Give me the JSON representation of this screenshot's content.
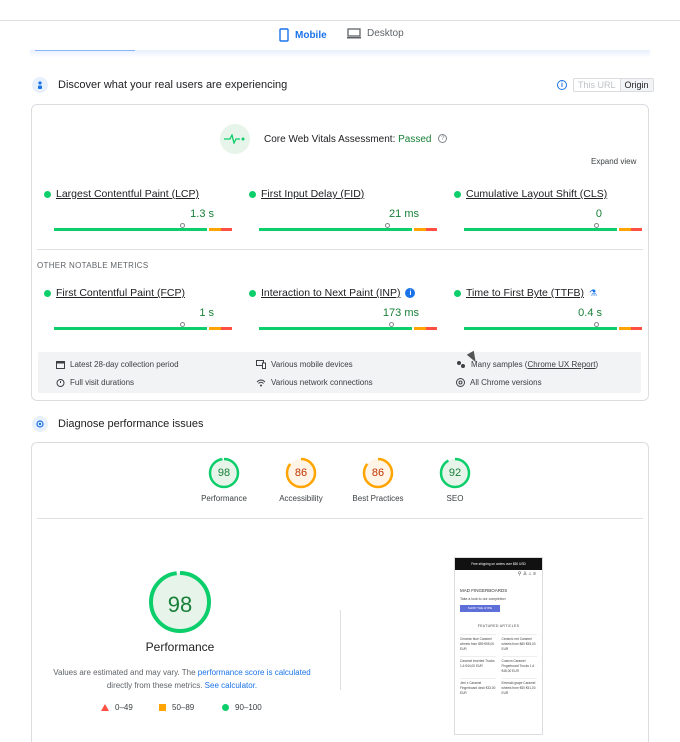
{
  "device_tabs": {
    "mobile": "Mobile",
    "desktop": "Desktop"
  },
  "field": {
    "heading": "Discover what your real users are experiencing",
    "toggle": {
      "this_url": "This URL",
      "origin": "Origin"
    },
    "assessment_label": "Core Web Vitals Assessment:",
    "assessment_status": "Passed",
    "expand": "Expand view",
    "core_metrics": [
      {
        "name": "Largest Contentful Paint (LCP)",
        "value": "1.3 s",
        "fraction": 0.72
      },
      {
        "name": "First Input Delay (FID)",
        "value": "21 ms",
        "fraction": 0.72
      },
      {
        "name": "Cumulative Layout Shift (CLS)",
        "value": "0",
        "fraction": 0.74
      }
    ],
    "other_label": "OTHER NOTABLE METRICS",
    "other_metrics": [
      {
        "name": "First Contentful Paint (FCP)",
        "value": "1 s",
        "fraction": 0.72
      },
      {
        "name": "Interaction to Next Paint (INP)",
        "value": "173 ms",
        "fraction": 0.74
      },
      {
        "name": "Time to First Byte (TTFB)",
        "value": "0.4 s",
        "fraction": 0.74
      }
    ],
    "info": {
      "period": "Latest 28-day collection period",
      "devices": "Various mobile devices",
      "samples_prefix": "Many samples (",
      "samples_link": "Chrome UX Report",
      "samples_suffix": ")",
      "durations": "Full visit durations",
      "network": "Various network connections",
      "versions": "All Chrome versions"
    }
  },
  "lab": {
    "heading": "Diagnose performance issues",
    "scores": [
      {
        "label": "Performance",
        "score": "98",
        "color": "#0cce6b"
      },
      {
        "label": "Accessibility",
        "score": "86",
        "color": "#ffa400"
      },
      {
        "label": "Best Practices",
        "score": "86",
        "color": "#ffa400"
      },
      {
        "label": "SEO",
        "score": "92",
        "color": "#0cce6b"
      }
    ],
    "big_score": "98",
    "big_label": "Performance",
    "note_1": "Values are estimated and may vary. The ",
    "note_link_1": "performance score is calculated",
    "note_2": "directly from these metrics. ",
    "note_link_2": "See calculator.",
    "legend": {
      "poor": "0–49",
      "average": "50–89",
      "good": "90–100"
    },
    "colors": {
      "good": "#0cce6b",
      "average": "#ffa400",
      "poor": "#ff4e42"
    }
  },
  "screenshot": {
    "banner": "Free shipping on orders over $50 USD",
    "brand": "MAD FINGERBOARDS",
    "tagline": "Take a look to our completion",
    "cta": "SHOP THE HYPE",
    "featured": "FEATURED ARTICLES",
    "items": [
      "Ceramic blue Caramel wheels from $59 €55,00 EUR",
      "Ceramic red Caramel wheels from $60 €55,00 EUR",
      "Caramel inverted Trucks 1.6 €44,00 EUR",
      "Custom Caramel Fingerboard Trucks 1.6 €48,00 EUR",
      "Jeni x Caramel Fingerboard deck €33,00 EUR",
      "Emerald grape Caramel wheels from €50 €51,00 EUR"
    ]
  }
}
